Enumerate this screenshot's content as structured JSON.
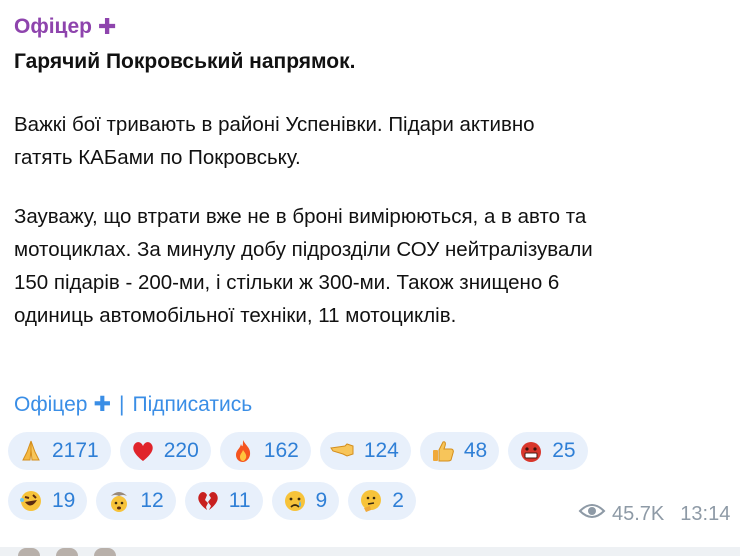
{
  "post": {
    "channel_name": "Офіцер",
    "headline": "Гарячий Покровський напрямок.",
    "paragraphs": [
      "Важкі бої тривають в районі  Успенівки. Підари активно\nгатять КАБами по Покровську.",
      "Зауважу, що втрати вже не в броні вимірюються, а в авто та\nмотоциклах. За минулу добу підрозділи СОУ нейтралізували\n150 підарів - 200-ми, і стільки ж 300-ми. Також знищено 6\nодиниць автомобільної техніки, 11 мотоциклів."
    ],
    "footer": {
      "channel_link": "Офіцер",
      "separator": "|",
      "subscribe": "Підписатись"
    }
  },
  "reactions": [
    [
      {
        "icon": "folded-hands-icon",
        "count": "2171"
      },
      {
        "icon": "red-heart-icon",
        "count": "220"
      },
      {
        "icon": "fire-icon",
        "count": "162"
      },
      {
        "icon": "backhand-pointing-icon",
        "count": "124"
      },
      {
        "icon": "thumbs-up-icon",
        "count": "48"
      },
      {
        "icon": "enraged-face-icon",
        "count": "25"
      }
    ],
    [
      {
        "icon": "rolling-laughing-icon",
        "count": "19"
      },
      {
        "icon": "exploding-head-icon",
        "count": "12"
      },
      {
        "icon": "broken-heart-icon",
        "count": "11"
      },
      {
        "icon": "crying-face-icon",
        "count": "9"
      },
      {
        "icon": "thinking-face-icon",
        "count": "2"
      }
    ]
  ],
  "meta": {
    "views": "45.7K",
    "time": "13:14"
  },
  "colors": {
    "channel_purple": "#8e44ad",
    "link_blue": "#3a8ee6",
    "pill_bg": "#e8f0fb",
    "count_blue": "#2f7fd6",
    "meta_gray": "#8e9aa6"
  }
}
